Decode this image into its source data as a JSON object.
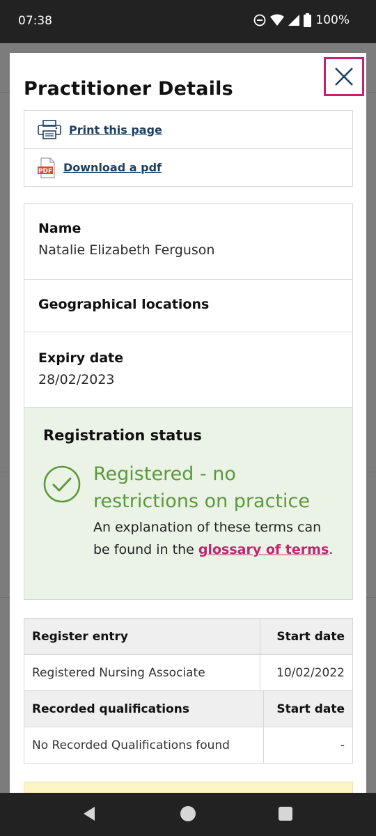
{
  "status_bar": {
    "time": "07:38",
    "battery": "100%",
    "icons": [
      "do-not-disturb-icon",
      "wifi-icon",
      "signal-icon",
      "battery-icon"
    ]
  },
  "modal": {
    "title": "Practitioner Details",
    "close_icon": "close-icon",
    "accent_color": "#c0246f",
    "actions": [
      {
        "label": "Print this page",
        "icon": "printer-icon"
      },
      {
        "label": "Download a pdf",
        "icon": "pdf-icon",
        "icon_text": "PDF"
      }
    ],
    "details": {
      "name_label": "Name",
      "name_value": "Natalie Elizabeth Ferguson",
      "geo_label": "Geographical locations",
      "expiry_label": "Expiry date",
      "expiry_value": "28/02/2023"
    },
    "registration": {
      "title": "Registration status",
      "status": "Registered - no restrictions on practice",
      "explain_prefix": "An explanation of these terms can be found in the",
      "glossary_link": "glossary of terms",
      "explain_suffix": ".",
      "status_color": "#5a9a3a",
      "icon": "check-circle-icon"
    },
    "register_table": {
      "headers": [
        "Register entry",
        "Start date"
      ],
      "rows": [
        [
          "Registered Nursing Associate",
          "10/02/2022"
        ]
      ]
    },
    "qualifications_table": {
      "headers": [
        "Recorded qualifications",
        "Start date"
      ],
      "rows": [
        [
          "No Recorded Qualifications found",
          "-"
        ]
      ]
    }
  },
  "nav_bar": {
    "icons": [
      "back-icon",
      "home-icon",
      "recents-icon"
    ]
  }
}
